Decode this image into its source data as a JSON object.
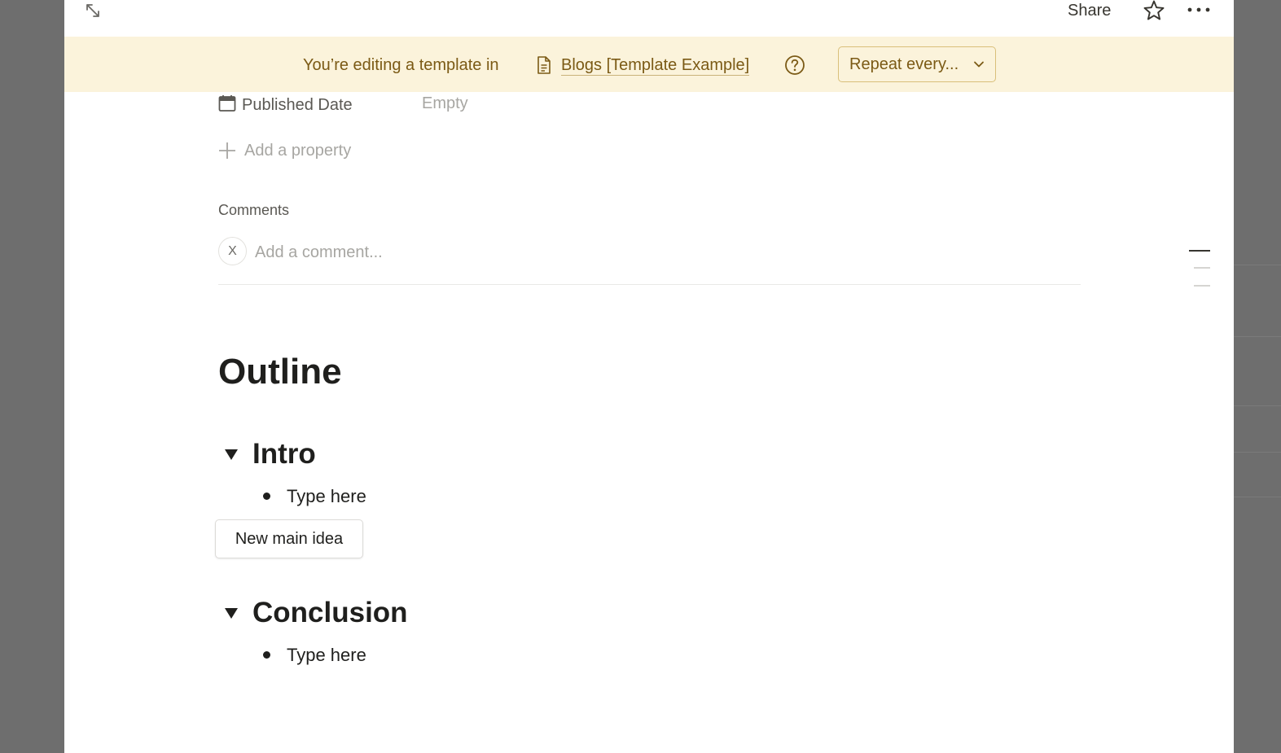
{
  "topbar": {
    "share_label": "Share"
  },
  "banner": {
    "text": "You’re editing a template in",
    "template_name": "Blogs [Template Example]",
    "repeat_label": "Repeat every..."
  },
  "properties": [
    {
      "label": "Published Date",
      "value": "Empty",
      "icon": "calendar-icon"
    }
  ],
  "add_property_label": "Add a property",
  "comments": {
    "title": "Comments",
    "avatar_initial": "X",
    "placeholder": "Add a comment..."
  },
  "content": {
    "heading": "Outline",
    "sections": [
      {
        "title": "Intro",
        "bullets": [
          "Type here"
        ]
      },
      {
        "title": "Conclusion",
        "bullets": [
          "Type here"
        ]
      }
    ],
    "button_label": "New main idea"
  },
  "colors": {
    "banner_bg": "#fbf3db",
    "banner_text": "#7b5a15",
    "backdrop": "#6e6e6e"
  }
}
